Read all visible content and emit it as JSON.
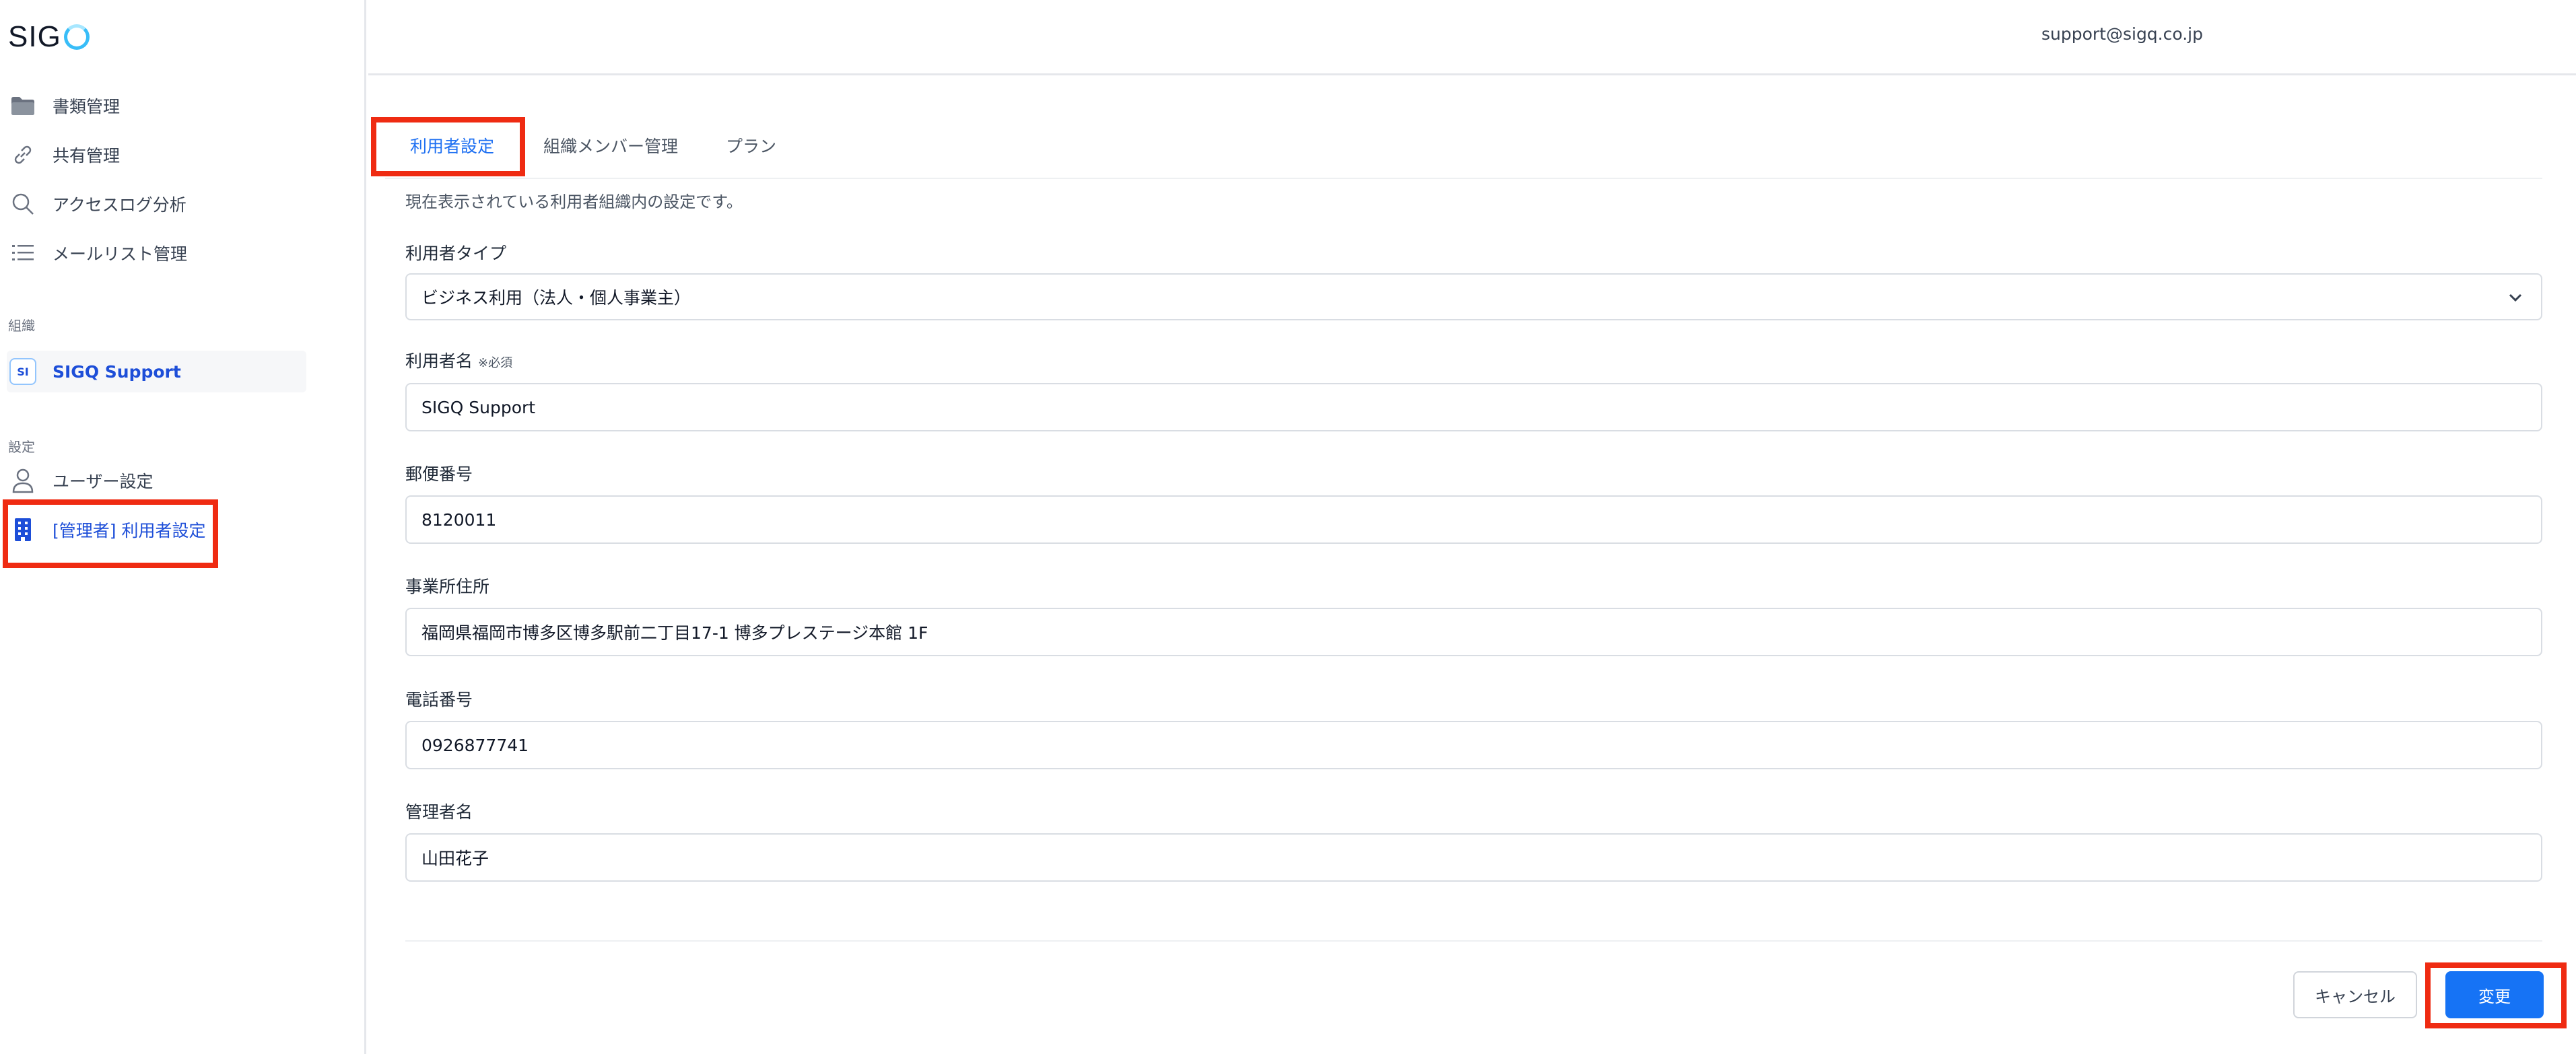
{
  "app": {
    "logo_text": "SIG",
    "user_email": "support@sigq.co.jp"
  },
  "sidebar": {
    "items": [
      {
        "label": "書類管理",
        "icon": "folder-icon"
      },
      {
        "label": "共有管理",
        "icon": "link-icon"
      },
      {
        "label": "アクセスログ分析",
        "icon": "search-icon"
      },
      {
        "label": "メールリスト管理",
        "icon": "list-icon"
      }
    ],
    "org_section_label": "組織",
    "org": {
      "badge": "SI",
      "label": "SIGQ Support"
    },
    "settings_section_label": "設定",
    "settings_items": [
      {
        "label": "ユーザー設定",
        "icon": "user-icon"
      },
      {
        "label": "[管理者] 利用者設定",
        "icon": "building-icon"
      }
    ]
  },
  "tabs": [
    {
      "label": "利用者設定",
      "active": true
    },
    {
      "label": "組織メンバー管理",
      "active": false
    },
    {
      "label": "プラン",
      "active": false
    }
  ],
  "form": {
    "description": "現在表示されている利用者組織内の設定です。",
    "user_type": {
      "label": "利用者タイプ",
      "value": "ビジネス利用（法人・個人事業主）"
    },
    "user_name": {
      "label": "利用者名",
      "required_note": "※必須",
      "value": "SIGQ Support"
    },
    "postal_code": {
      "label": "郵便番号",
      "value": "8120011"
    },
    "address": {
      "label": "事業所住所",
      "value": "福岡県福岡市博多区博多駅前二丁目17-1 博多プレステージ本館 1F"
    },
    "phone": {
      "label": "電話番号",
      "value": "0926877741"
    },
    "admin_name": {
      "label": "管理者名",
      "value": "山田花子"
    }
  },
  "actions": {
    "cancel_label": "キャンセル",
    "submit_label": "変更"
  },
  "colors": {
    "accent": "#1673f5",
    "highlight": "#ef2b12"
  }
}
